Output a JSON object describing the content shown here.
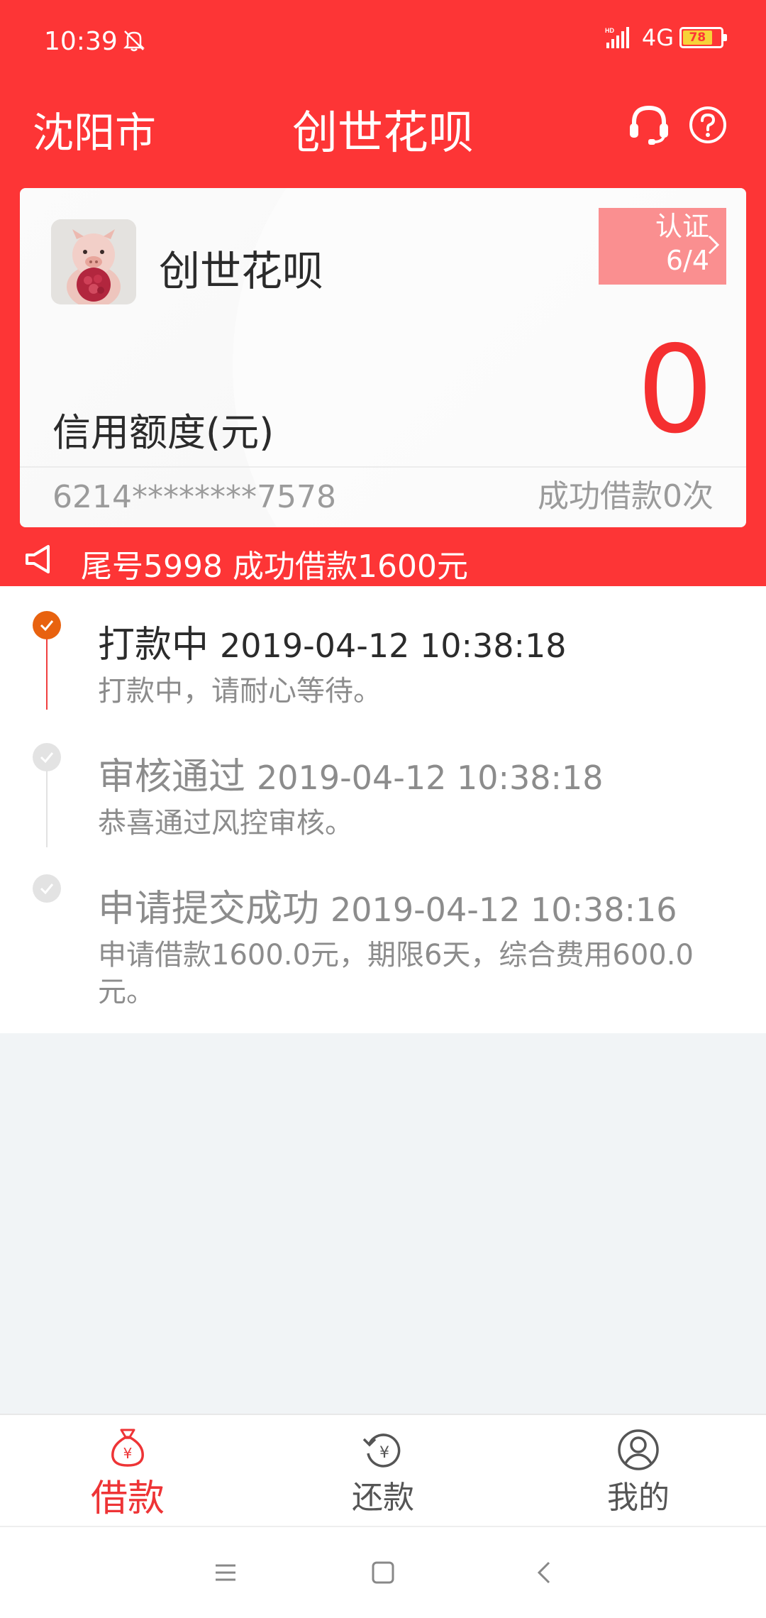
{
  "status_bar": {
    "time": "10:39",
    "network": "4G",
    "battery": "78",
    "battery_level": 0.78
  },
  "header": {
    "city": "沈阳市",
    "title": "创世花呗"
  },
  "card": {
    "name": "创世花呗",
    "cert_label": "认证",
    "cert_progress": "6/4",
    "credit_label": "信用额度(元)",
    "credit_value": "0",
    "card_number": "6214********7578",
    "loan_count": "成功借款0次"
  },
  "notice": {
    "text": "尾号5998 成功借款1600元"
  },
  "timeline": [
    {
      "title": "打款中",
      "time": "2019-04-12 10:38:18",
      "desc": "打款中，请耐心等待。",
      "status": "active"
    },
    {
      "title": "审核通过",
      "time": "2019-04-12 10:38:18",
      "desc": "恭喜通过风控审核。",
      "status": "done"
    },
    {
      "title": "申请提交成功",
      "time": "2019-04-12 10:38:16",
      "desc": "申请借款1600.0元，期限6天，综合费用600.0元。",
      "status": "done"
    }
  ],
  "tabs": [
    {
      "label": "借款",
      "icon": "money-bag-icon",
      "active": true
    },
    {
      "label": "还款",
      "icon": "repay-icon",
      "active": false
    },
    {
      "label": "我的",
      "icon": "user-icon",
      "active": false
    }
  ],
  "colors": {
    "brand_red": "#fd3536",
    "active_orange": "#e8620f",
    "credit_red": "#f52f30"
  }
}
